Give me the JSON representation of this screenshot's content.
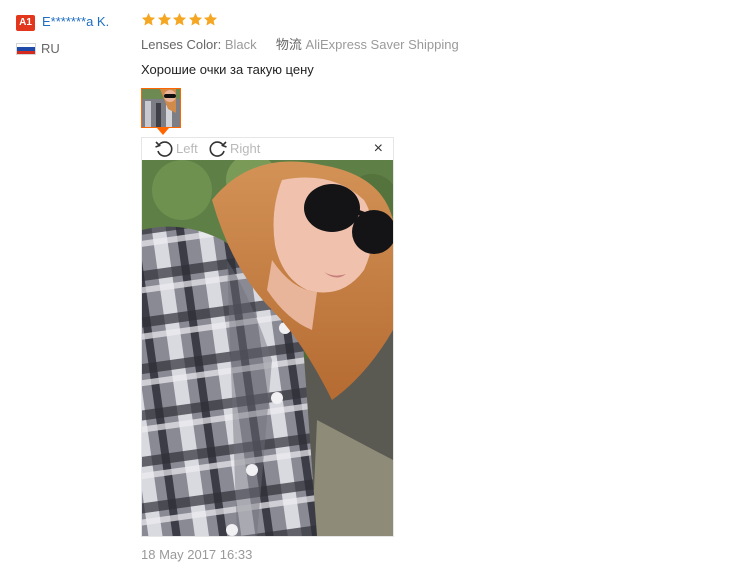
{
  "reviewer": {
    "level_badge": "A1",
    "name": "E*******a K.",
    "country_code": "RU",
    "flag_colors": [
      "#ffffff",
      "#1f4aa8",
      "#d52b1e"
    ]
  },
  "review": {
    "rating": 5,
    "star_color": "#f5a623",
    "properties": [
      {
        "name": "Lenses Color:",
        "value": "Black"
      },
      {
        "name": "物流",
        "value": "AliExpress Saver Shipping"
      }
    ],
    "text": "Хорошие очки за такую цену",
    "date": "18 May 2017 16:33"
  },
  "viewer": {
    "rotate_left_label": "Left",
    "rotate_right_label": "Right",
    "close_label": "×"
  },
  "colors": {
    "accent": "#ff6600",
    "username_link": "#1f6ec1",
    "badge": "#e2371c"
  }
}
